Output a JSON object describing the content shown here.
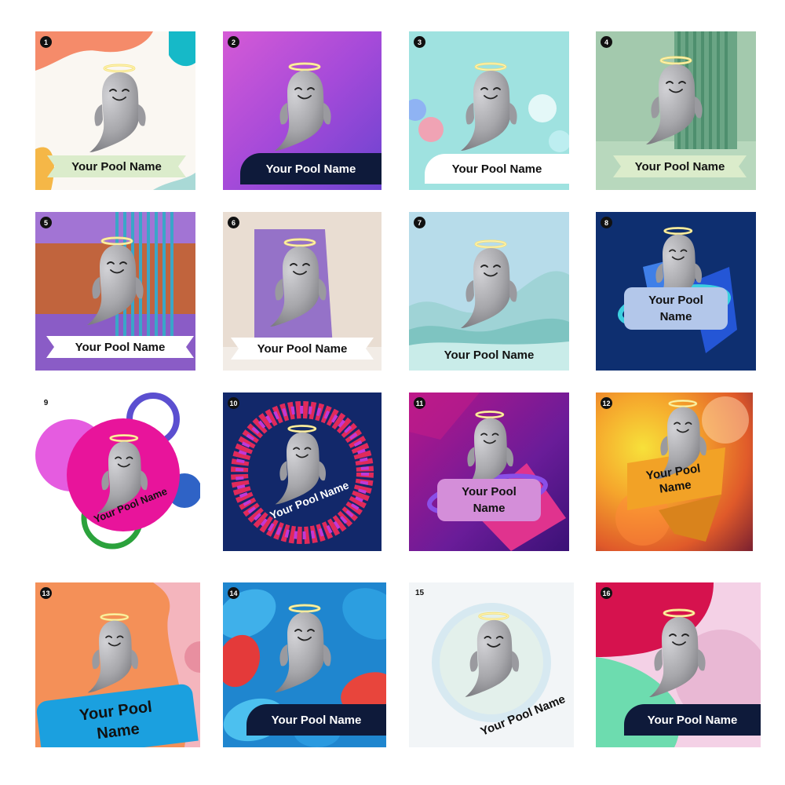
{
  "tiles": [
    {
      "number": "1",
      "label": "Your Pool Name"
    },
    {
      "number": "2",
      "label": "Your Pool Name"
    },
    {
      "number": "3",
      "label": "Your Pool Name"
    },
    {
      "number": "4",
      "label": "Your Pool Name"
    },
    {
      "number": "5",
      "label": "Your Pool Name"
    },
    {
      "number": "6",
      "label": "Your Pool Name"
    },
    {
      "number": "7",
      "label": "Your Pool Name"
    },
    {
      "number": "8",
      "label_line1": "Your Pool",
      "label_line2": "Name"
    },
    {
      "number": "9",
      "label": "Your Pool Name"
    },
    {
      "number": "10",
      "label": "Your Pool Name"
    },
    {
      "number": "11",
      "label_line1": "Your Pool",
      "label_line2": "Name"
    },
    {
      "number": "12",
      "label_line1": "Your Pool",
      "label_line2": "Name"
    },
    {
      "number": "13",
      "label_line1": "Your Pool",
      "label_line2": "Name"
    },
    {
      "number": "14",
      "label": "Your Pool Name"
    },
    {
      "number": "15",
      "label": "Your Pool Name"
    },
    {
      "number": "16",
      "label": "Your Pool Name"
    }
  ],
  "icons": {
    "mascot": "ghost-with-halo-icon"
  },
  "colors": {
    "ghost": "#a9a9ad",
    "halo": "#f3e27a",
    "dark_label": "#0e1a3a"
  }
}
